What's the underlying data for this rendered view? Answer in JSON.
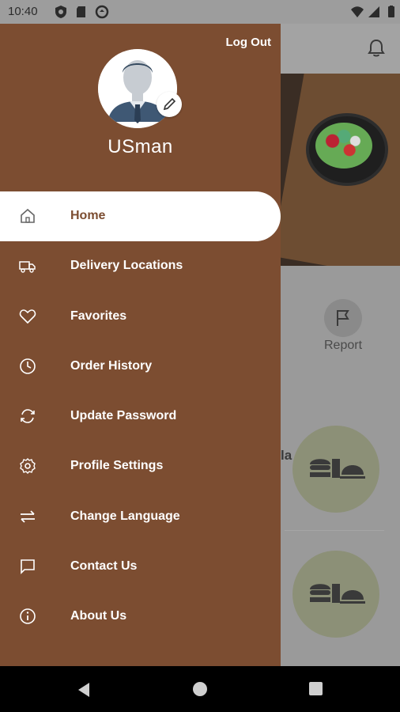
{
  "status_bar": {
    "time": "10:40"
  },
  "drawer": {
    "logout_label": "Log Out",
    "username": "USman",
    "menu": [
      {
        "label": "Home",
        "icon": "home-icon",
        "active": true
      },
      {
        "label": "Delivery Locations",
        "icon": "truck-icon"
      },
      {
        "label": "Favorites",
        "icon": "heart-icon"
      },
      {
        "label": "Order History",
        "icon": "clock-icon"
      },
      {
        "label": "Update Password",
        "icon": "refresh-icon"
      },
      {
        "label": "Profile Settings",
        "icon": "gear-icon"
      },
      {
        "label": "Change Language",
        "icon": "swap-icon"
      },
      {
        "label": "Contact Us",
        "icon": "chat-icon"
      },
      {
        "label": "About Us",
        "icon": "info-icon"
      }
    ]
  },
  "background": {
    "report_label": "Report",
    "partial_text": "la"
  },
  "colors": {
    "drawer": "#7c4d31",
    "active_text": "#7c4d31"
  }
}
